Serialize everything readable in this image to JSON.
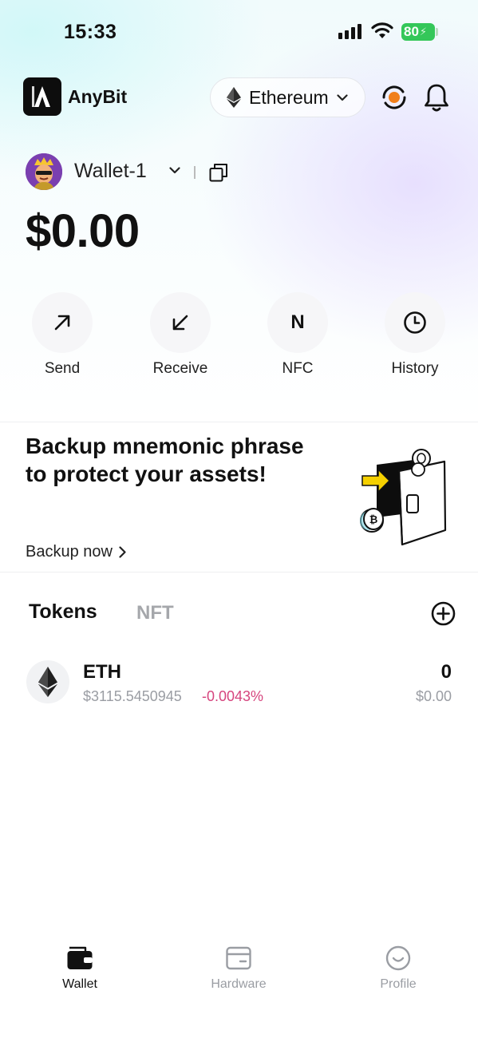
{
  "status_bar": {
    "time": "15:33",
    "battery": "80"
  },
  "header": {
    "brand": "AnyBit",
    "network": "Ethereum"
  },
  "wallet": {
    "name": "Wallet-1",
    "balance": "$0.00"
  },
  "actions": [
    {
      "label": "Send",
      "icon": "arrow-up-right-icon"
    },
    {
      "label": "Receive",
      "icon": "arrow-down-left-icon"
    },
    {
      "label": "NFC",
      "icon": "nfc-icon",
      "glyph": "N"
    },
    {
      "label": "History",
      "icon": "clock-icon"
    }
  ],
  "backup": {
    "title": "Backup mnemonic phrase to protect your assets!",
    "link": "Backup now"
  },
  "token_tabs": {
    "tokens": "Tokens",
    "nft": "NFT"
  },
  "tokens": [
    {
      "symbol": "ETH",
      "price": "$3115.5450945",
      "change": "-0.0043%",
      "amount": "0",
      "value": "$0.00"
    }
  ],
  "bottom_nav": [
    {
      "label": "Wallet",
      "active": true
    },
    {
      "label": "Hardware",
      "active": false
    },
    {
      "label": "Profile",
      "active": false
    }
  ],
  "colors": {
    "accent_orange": "#f07f1b",
    "negative_change": "#d6457e",
    "battery_green": "#34c759",
    "muted_text": "#9a9da3"
  }
}
